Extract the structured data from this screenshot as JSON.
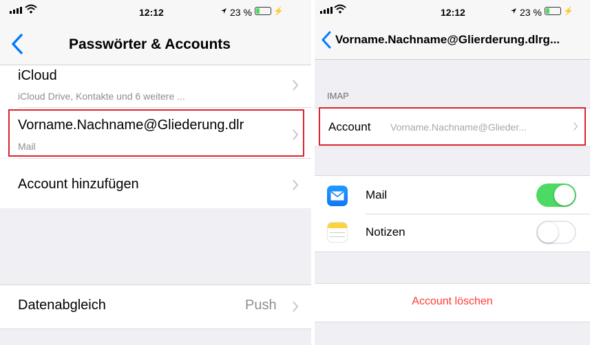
{
  "left": {
    "status": {
      "time": "12:12",
      "location_icon": "location-arrow-icon",
      "battery": "23 %",
      "battery_level": 0.23
    },
    "nav": {
      "title": "Passwörter & Accounts",
      "back_icon": "chevron-left-icon"
    },
    "icloud": {
      "label": "iCloud",
      "sublabel": "iCloud Drive, Kontakte und 6 weitere ..."
    },
    "account": {
      "label": "Vorname.Nachname@Gliederung.dlr",
      "sublabel": "Mail"
    },
    "add_account": {
      "label": "Account hinzufügen"
    },
    "fetch": {
      "label": "Datenabgleich",
      "value": "Push"
    },
    "highlight_color": "#d9232d"
  },
  "right": {
    "status": {
      "time": "12:12",
      "battery": "23 %",
      "battery_level": 0.23
    },
    "nav": {
      "title": "Vorname.Nachname@Glierderung.dlrg..."
    },
    "section_header": "IMAP",
    "account_row": {
      "label": "Account",
      "value": "Vorname.Nachname@Glieder..."
    },
    "mail": {
      "label": "Mail",
      "enabled": true,
      "icon": "mail-app-icon"
    },
    "notes": {
      "label": "Notizen",
      "enabled": false,
      "icon": "notes-app-icon"
    },
    "delete": {
      "label": "Account löschen"
    },
    "colors": {
      "ios_blue": "#007aff",
      "toggle_on": "#4cd964",
      "delete_red": "#ff3b30"
    }
  }
}
